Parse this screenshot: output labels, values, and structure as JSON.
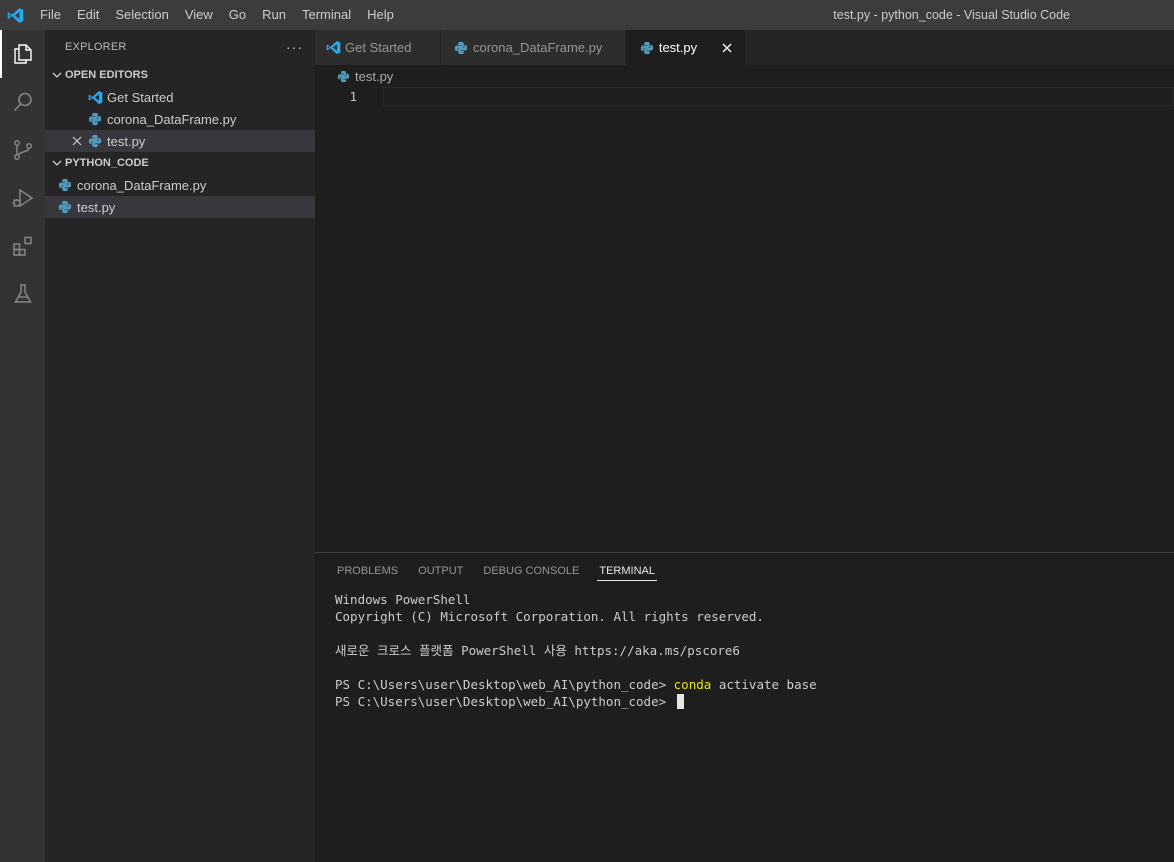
{
  "titlebar": {
    "menu": [
      "File",
      "Edit",
      "Selection",
      "View",
      "Go",
      "Run",
      "Terminal",
      "Help"
    ],
    "window_title": "test.py - python_code - Visual Studio Code"
  },
  "activity_bar": {
    "items": [
      "explorer-icon",
      "search-icon",
      "source-control-icon",
      "run-debug-icon",
      "extensions-icon",
      "testing-icon"
    ]
  },
  "sidebar": {
    "title": "EXPLORER",
    "more": "···",
    "open_editors": {
      "label": "OPEN EDITORS",
      "items": [
        "Get Started",
        "corona_DataFrame.py",
        "test.py"
      ]
    },
    "folder": {
      "label": "PYTHON_CODE",
      "items": [
        "corona_DataFrame.py",
        "test.py"
      ]
    }
  },
  "editor": {
    "tabs": [
      "Get Started",
      "corona_DataFrame.py",
      "test.py"
    ],
    "breadcrumb": "test.py",
    "line_number": "1"
  },
  "panel": {
    "tabs": [
      "PROBLEMS",
      "OUTPUT",
      "DEBUG CONSOLE",
      "TERMINAL"
    ],
    "terminal": {
      "line1": "Windows PowerShell",
      "line2": "Copyright (C) Microsoft Corporation. All rights reserved.",
      "line3": "새로운 크로스 플랫폼 PowerShell 사용 https://aka.ms/pscore6",
      "prompt": "PS C:\\Users\\user\\Desktop\\web_AI\\python_code> ",
      "command_keyword": "conda",
      "command_rest": " activate base"
    }
  },
  "colors": {
    "accent_blue": "#23a9f2",
    "python_icon": "#519aba",
    "terminal_keyword": "#e5e510"
  }
}
